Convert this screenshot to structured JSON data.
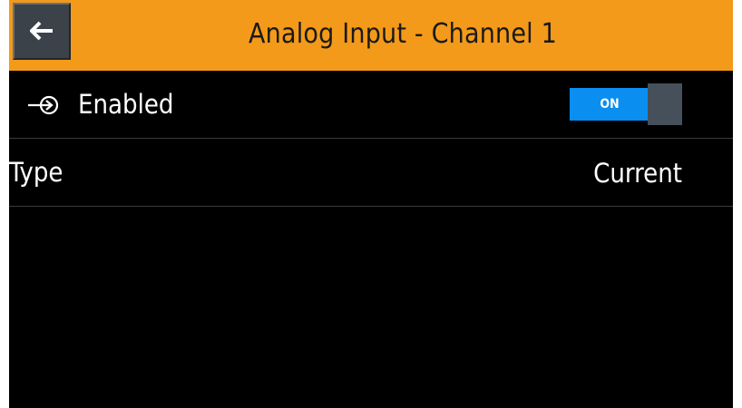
{
  "header": {
    "title": "Analog Input - Channel 1",
    "back_icon": "arrow-left-icon",
    "accent_color": "#f39a1a"
  },
  "settings": {
    "enabled": {
      "label": "Enabled",
      "icon": "input-arrow-icon",
      "toggle_label": "ON",
      "toggle_state": true,
      "toggle_color": "#0a8ef0"
    },
    "type": {
      "label": "Type",
      "value": "Current"
    }
  }
}
